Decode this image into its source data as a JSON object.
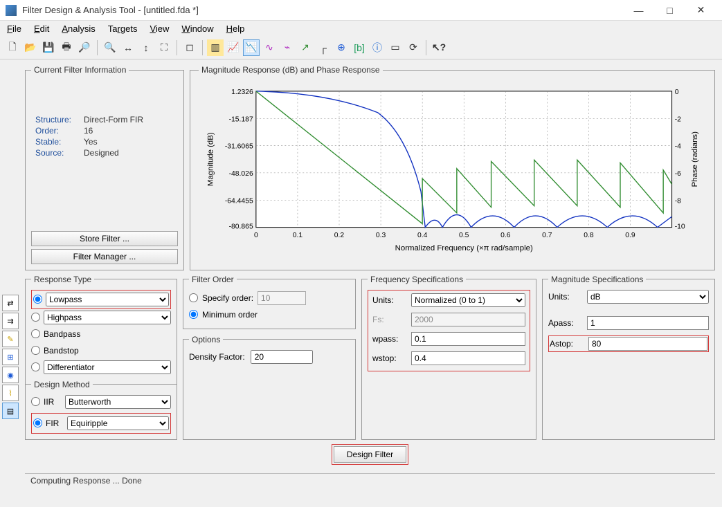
{
  "window": {
    "title": "Filter Design & Analysis Tool -   [untitled.fda *]"
  },
  "menu": {
    "file": "File",
    "edit": "Edit",
    "analysis": "Analysis",
    "targets": "Targets",
    "view": "View",
    "window": "Window",
    "help": "Help"
  },
  "cfi": {
    "legend": "Current Filter Information",
    "rows": {
      "structure_l": "Structure:",
      "structure_v": "Direct-Form FIR",
      "order_l": "Order:",
      "order_v": "16",
      "stable_l": "Stable:",
      "stable_v": "Yes",
      "source_l": "Source:",
      "source_v": "Designed"
    },
    "store_btn": "Store Filter ...",
    "mgr_btn": "Filter Manager ..."
  },
  "plot": {
    "legend": "Magnitude Response (dB) and Phase Response",
    "xlabel": "Normalized Frequency (×π rad/sample)",
    "ylabel_l": "Magnitude (dB)",
    "ylabel_r": "Phase (radians)"
  },
  "resp": {
    "legend": "Response Type",
    "lowpass": "Lowpass",
    "highpass": "Highpass",
    "bandpass": "Bandpass",
    "bandstop": "Bandstop",
    "diff": "Differentiator",
    "dm_legend": "Design Method",
    "iir": "IIR",
    "iir_sel": "Butterworth",
    "fir": "FIR",
    "fir_sel": "Equiripple"
  },
  "fo": {
    "legend": "Filter Order",
    "specify": "Specify order:",
    "specify_val": "10",
    "min": "Minimum order"
  },
  "opt": {
    "legend": "Options",
    "dfactor": "Density Factor:",
    "dfactor_val": "20"
  },
  "freq": {
    "legend": "Frequency Specifications",
    "units": "Units:",
    "units_val": "Normalized (0 to 1)",
    "fs": "Fs:",
    "fs_val": "2000",
    "wpass": "wpass:",
    "wpass_val": "0.1",
    "wstop": "wstop:",
    "wstop_val": "0.4"
  },
  "mag": {
    "legend": "Magnitude Specifications",
    "units": "Units:",
    "units_val": "dB",
    "apass": "Apass:",
    "apass_val": "1",
    "astop": "Astop:",
    "astop_val": "80"
  },
  "design_btn": "Design Filter",
  "status": "Computing Response ... Done",
  "chart_data": {
    "type": "line",
    "xlabel": "Normalized Frequency (×π rad/sample)",
    "x_ticks": [
      0,
      0.1,
      0.2,
      0.3,
      0.4,
      0.5,
      0.6,
      0.7,
      0.8,
      0.9
    ],
    "y_left_label": "Magnitude (dB)",
    "y_left_ticks": [
      1.2326,
      -15.187,
      -31.6065,
      -48.026,
      -64.4455,
      -80.865
    ],
    "y_right_label": "Phase (radians)",
    "y_right_ticks": [
      0,
      -2,
      -4,
      -6,
      -8,
      -10
    ],
    "series": [
      {
        "name": "Magnitude (dB)",
        "color": "#1030c0",
        "x": [
          0,
          0.05,
          0.1,
          0.15,
          0.2,
          0.25,
          0.3,
          0.35,
          0.38,
          0.4,
          0.42,
          0.45,
          0.48,
          0.5,
          0.55,
          0.58,
          0.62,
          0.66,
          0.72,
          0.76,
          0.82,
          0.88,
          0.94,
          1.0
        ],
        "y": [
          1.2,
          1.0,
          0.8,
          0.0,
          -2,
          -6,
          -14,
          -30,
          -60,
          -81,
          -85,
          -80,
          -85,
          -81,
          -85,
          -81,
          -85,
          -81,
          -85,
          -81,
          -85,
          -81,
          -85,
          -81
        ]
      },
      {
        "name": "Phase (radians)",
        "color": "#2e8b2e",
        "x": [
          0,
          0.4,
          0.4,
          0.48,
          0.48,
          0.56,
          0.56,
          0.66,
          0.66,
          0.76,
          0.76,
          0.86,
          0.86,
          0.96,
          0.96,
          1.0
        ],
        "y": [
          0,
          -9.8,
          -6.5,
          -8.8,
          -5.6,
          -8.3,
          -5.0,
          -8.1,
          -4.9,
          -8.1,
          -4.9,
          -8.2,
          -5.0,
          -8.5,
          -5.3,
          -6.5
        ]
      }
    ]
  }
}
